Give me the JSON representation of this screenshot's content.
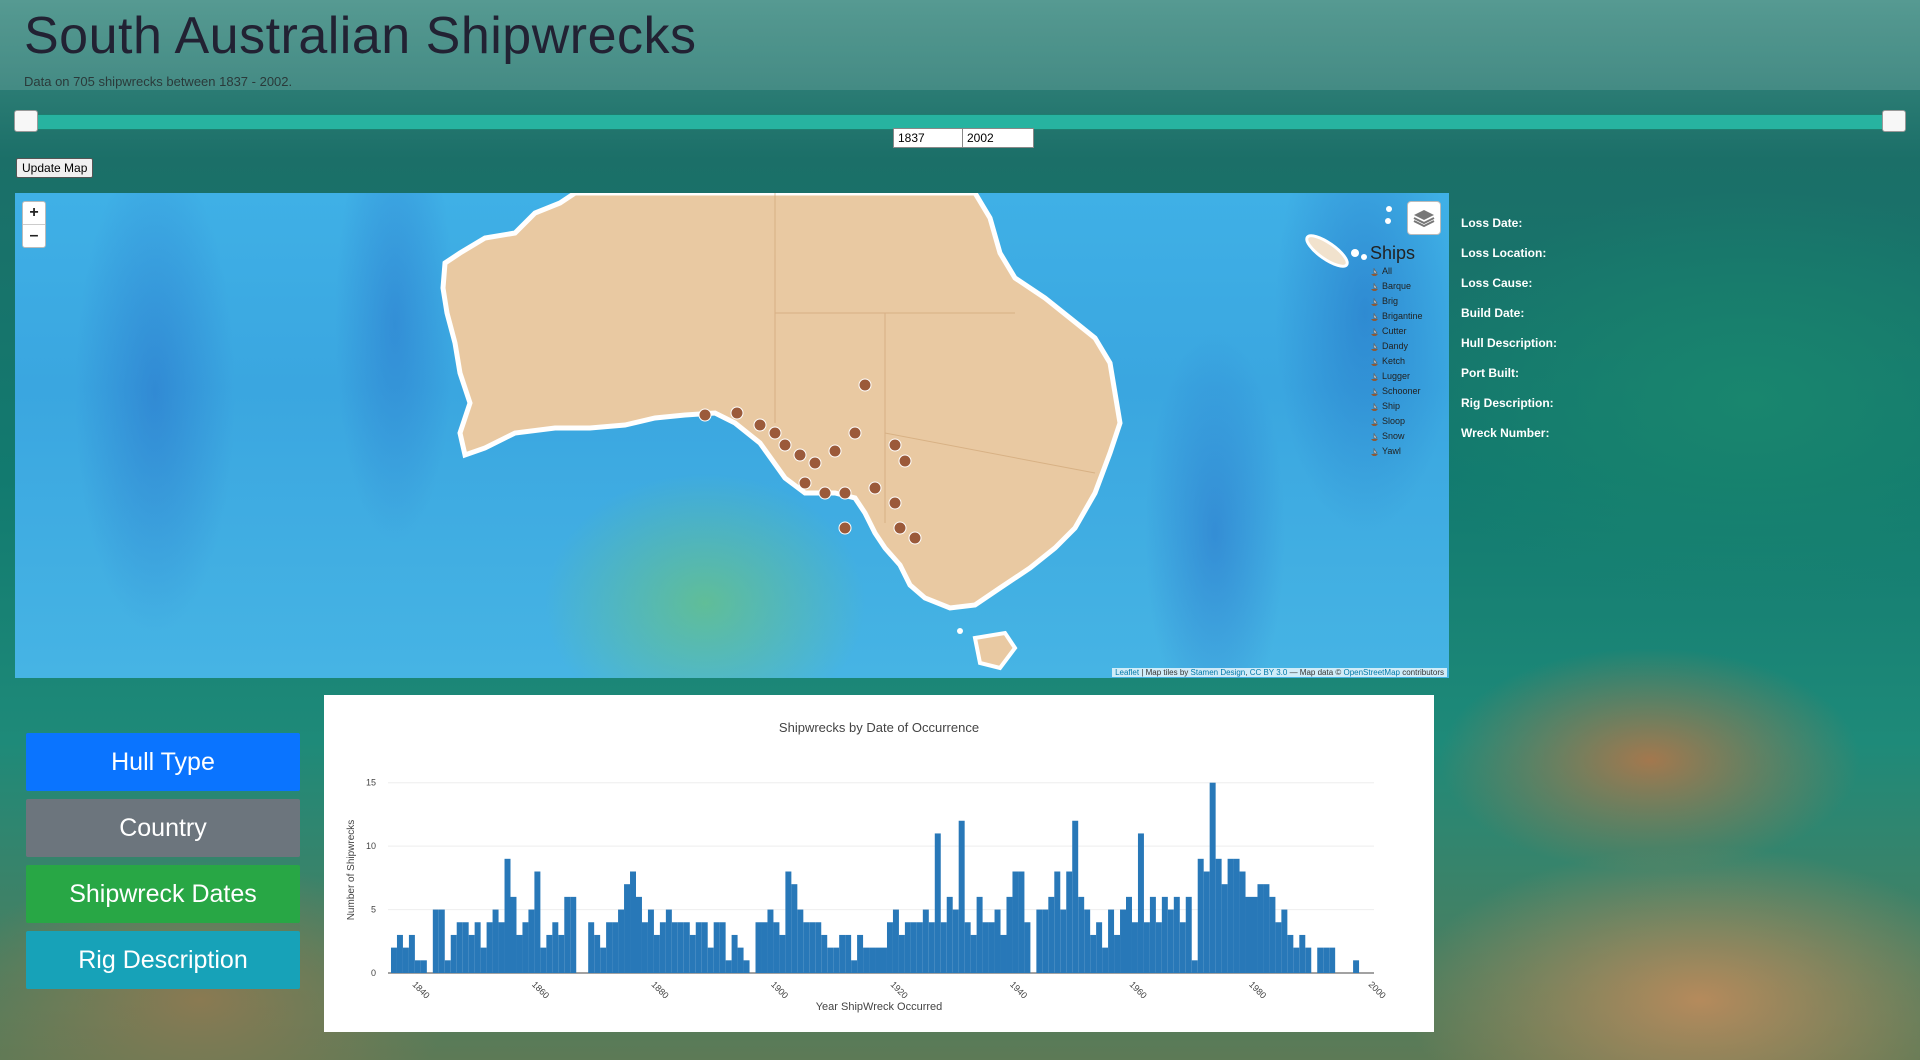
{
  "page": {
    "title": "South Australian Shipwrecks",
    "subtitle": "Data on 705 shipwrecks between 1837 - 2002."
  },
  "range": {
    "start_year": "1837",
    "end_year": "2002",
    "start_fraction": 0,
    "end_fraction": 1
  },
  "controls": {
    "update_label": "Update Map",
    "zoom_in": "+",
    "zoom_out": "–"
  },
  "map": {
    "attribution_leaflet": "Leaflet",
    "attribution_rest": " | Map tiles by ",
    "attribution_stamen": "Stamen Design",
    "attribution_cc": "CC BY 3.0",
    "attribution_mid": " — Map data © ",
    "attribution_osm": "OpenStreetMap",
    "attribution_end": " contributors"
  },
  "legend": {
    "title": "Ships",
    "items": [
      "All",
      "Barque",
      "Brig",
      "Brigantine",
      "Cutter",
      "Dandy",
      "Ketch",
      "Lugger",
      "Schooner",
      "Ship",
      "Sloop",
      "Snow",
      "Yawl"
    ]
  },
  "details": {
    "labels": [
      "Loss Date:",
      "Loss Location:",
      "Loss Cause:",
      "Build Date:",
      "Hull Description:",
      "Port Built:",
      "Rig Description:",
      "Wreck Number:"
    ]
  },
  "nav": {
    "hull": {
      "label": "Hull Type",
      "color": "#0a74ff"
    },
    "country": {
      "label": "Country",
      "color": "#6c757d"
    },
    "dates": {
      "label": "Shipwreck Dates",
      "color": "#28a745"
    },
    "rig": {
      "label": "Rig Description",
      "color": "#17a2b8"
    }
  },
  "chart_data": {
    "type": "bar",
    "title": "Shipwrecks by Date of Occurrence",
    "xlabel": "Year ShipWreck Occurred",
    "ylabel": "Number of Shipwrecks",
    "xlim": [
      1836,
      2001
    ],
    "ylim": [
      0,
      16
    ],
    "xticks": [
      1840,
      1860,
      1880,
      1900,
      1920,
      1940,
      1960,
      1980,
      2000
    ],
    "yticks": [
      0,
      5,
      10,
      15
    ],
    "color": "#2878b8",
    "years": [
      1837,
      1838,
      1839,
      1840,
      1841,
      1842,
      1843,
      1844,
      1845,
      1846,
      1847,
      1848,
      1849,
      1850,
      1851,
      1852,
      1853,
      1854,
      1855,
      1856,
      1857,
      1858,
      1859,
      1860,
      1861,
      1862,
      1863,
      1864,
      1865,
      1866,
      1867,
      1868,
      1869,
      1870,
      1871,
      1872,
      1873,
      1874,
      1875,
      1876,
      1877,
      1878,
      1879,
      1880,
      1881,
      1882,
      1883,
      1884,
      1885,
      1886,
      1887,
      1888,
      1889,
      1890,
      1891,
      1892,
      1893,
      1894,
      1895,
      1896,
      1897,
      1898,
      1899,
      1900,
      1901,
      1902,
      1903,
      1904,
      1905,
      1906,
      1907,
      1908,
      1909,
      1910,
      1911,
      1912,
      1913,
      1914,
      1915,
      1916,
      1917,
      1918,
      1919,
      1920,
      1921,
      1922,
      1923,
      1924,
      1925,
      1926,
      1927,
      1928,
      1929,
      1930,
      1931,
      1932,
      1933,
      1934,
      1935,
      1936,
      1937,
      1938,
      1939,
      1940,
      1941,
      1942,
      1943,
      1944,
      1945,
      1946,
      1947,
      1948,
      1949,
      1950,
      1951,
      1952,
      1953,
      1954,
      1955,
      1956,
      1957,
      1958,
      1959,
      1960,
      1961,
      1962,
      1963,
      1964,
      1965,
      1966,
      1967,
      1968,
      1969,
      1970,
      1971,
      1972,
      1973,
      1974,
      1975,
      1976,
      1977,
      1978,
      1979,
      1980,
      1981,
      1982,
      1983,
      1984,
      1985,
      1986,
      1987,
      1988,
      1989,
      1990,
      1991,
      1992,
      1993,
      1994,
      1995,
      1996,
      1997,
      1998,
      1999,
      2000,
      2001,
      2002
    ],
    "values": [
      2,
      3,
      2,
      3,
      1,
      1,
      0,
      5,
      5,
      1,
      3,
      4,
      4,
      3,
      4,
      2,
      4,
      5,
      4,
      9,
      6,
      3,
      4,
      5,
      8,
      2,
      3,
      4,
      3,
      6,
      6,
      0,
      0,
      4,
      3,
      2,
      4,
      4,
      5,
      7,
      8,
      6,
      4,
      5,
      3,
      4,
      5,
      4,
      4,
      4,
      3,
      4,
      4,
      2,
      4,
      4,
      1,
      3,
      2,
      1,
      0,
      4,
      4,
      5,
      4,
      3,
      8,
      7,
      5,
      4,
      4,
      4,
      3,
      2,
      2,
      3,
      3,
      1,
      3,
      2,
      2,
      2,
      2,
      4,
      5,
      3,
      4,
      4,
      4,
      5,
      4,
      11,
      4,
      6,
      5,
      12,
      4,
      3,
      6,
      4,
      4,
      5,
      3,
      6,
      8,
      8,
      4,
      0,
      5,
      5,
      6,
      8,
      5,
      8,
      12,
      6,
      5,
      3,
      4,
      2,
      5,
      3,
      5,
      6,
      4,
      11,
      4,
      6,
      4,
      6,
      5,
      6,
      4,
      6,
      1,
      9,
      8,
      15,
      9,
      7,
      9,
      9,
      8,
      6,
      6,
      7,
      7,
      6,
      4,
      5,
      3,
      2,
      3,
      2,
      0,
      2,
      2,
      2,
      0,
      0,
      0,
      1
    ]
  }
}
